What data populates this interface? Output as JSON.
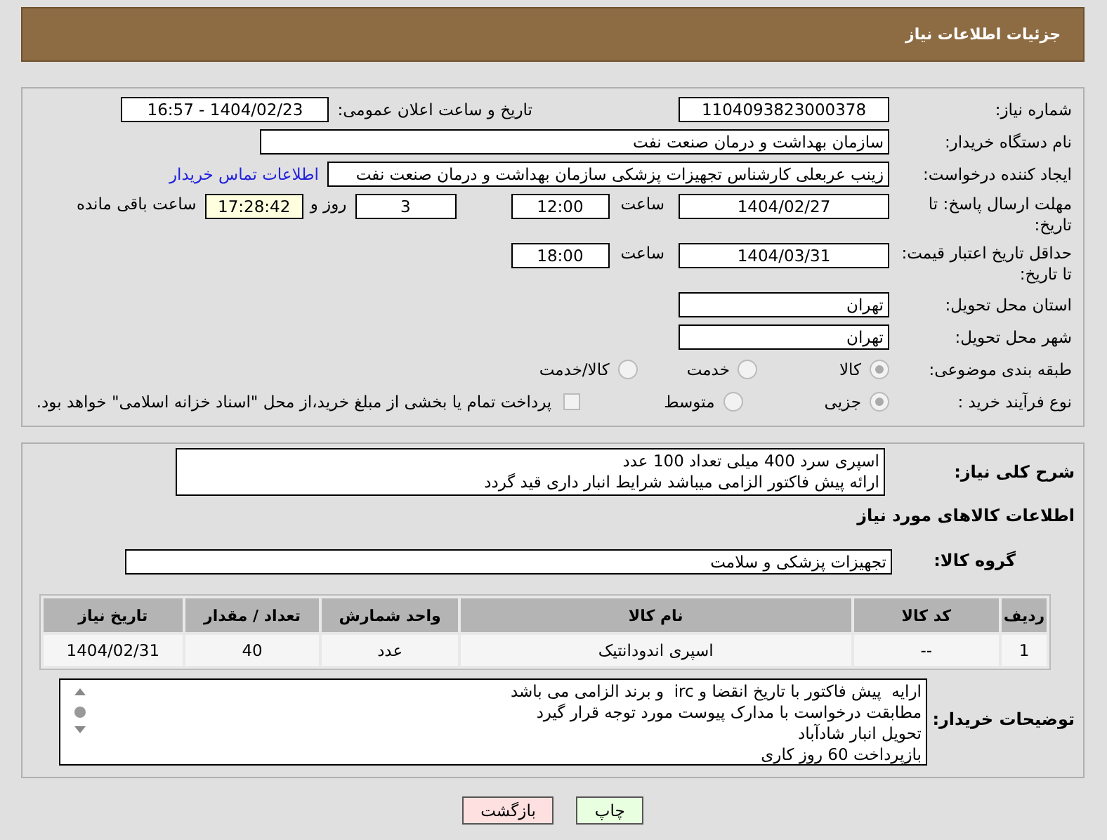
{
  "header": {
    "title": "جزئیات اطلاعات نیاز"
  },
  "need_number": {
    "label": "شماره نیاز:",
    "value": "1104093823000378"
  },
  "announce": {
    "label": "تاریخ و ساعت اعلان عمومی:",
    "value": "1404/02/23 - 16:57"
  },
  "buyer_org": {
    "label": "نام دستگاه خریدار:",
    "value": "سازمان بهداشت و درمان صنعت نفت"
  },
  "requester": {
    "label": "ایجاد کننده درخواست:",
    "value": "زینب عربعلی کارشناس تجهیزات پزشکی سازمان بهداشت و درمان صنعت نفت",
    "link": "اطلاعات تماس خریدار"
  },
  "deadline": {
    "label": "مهلت ارسال پاسخ: تا تاریخ:",
    "date": "1404/02/27",
    "time_label": "ساعت",
    "time": "12:00",
    "days": "3",
    "days_label": "روز و",
    "remaining": "17:28:42",
    "remaining_label": "ساعت باقی مانده"
  },
  "validity": {
    "label": "حداقل تاریخ اعتبار قیمت: تا تاریخ:",
    "date": "1404/03/31",
    "time_label": "ساعت",
    "time": "18:00"
  },
  "province": {
    "label": "استان محل تحویل:",
    "value": "تهران"
  },
  "city": {
    "label": "شهر محل تحویل:",
    "value": "تهران"
  },
  "category": {
    "label": "طبقه بندی موضوعی:",
    "options": [
      {
        "label": "کالا",
        "selected": true
      },
      {
        "label": "خدمت",
        "selected": false
      },
      {
        "label": "کالا/خدمت",
        "selected": false
      }
    ]
  },
  "process": {
    "label": "نوع فرآیند خرید :",
    "options": [
      {
        "label": "جزیی",
        "selected": true
      },
      {
        "label": "متوسط",
        "selected": false
      }
    ],
    "treasury": {
      "checked": false,
      "label": "پرداخت تمام یا بخشی از مبلغ خرید،از محل \"اسناد خزانه اسلامی\" خواهد بود."
    }
  },
  "description": {
    "label": "شرح کلی نیاز:",
    "lines": [
      "اسپری سرد 400 میلی تعداد 100 عدد",
      "ارائه پیش فاکتور الزامی میباشد شرایط انبار داری قید گردد"
    ]
  },
  "goods_heading": "اطلاعات کالاهای مورد نیاز",
  "goods_group": {
    "label": "گروه کالا:",
    "value": "تجهیزات پزشکی و سلامت"
  },
  "table": {
    "columns": [
      "ردیف",
      "کد کالا",
      "نام کالا",
      "واحد شمارش",
      "تعداد / مقدار",
      "تاریخ نیاز"
    ],
    "rows": [
      [
        "1",
        "--",
        "اسپری اندودانتیک",
        "عدد",
        "40",
        "1404/02/31"
      ]
    ]
  },
  "buyer_notes": {
    "label": "توضیحات خریدار:",
    "lines": [
      "ارایه  پیش فاکتور با تاریخ انقضا و irc  و برند الزامی می باشد",
      "مطابقت درخواست با مدارک پیوست مورد توجه قرار گیرد",
      "تحویل انبار شادآباد",
      "بازپرداخت 60 روز کاری"
    ]
  },
  "buttons": {
    "print": "چاپ",
    "back": "بازگشت"
  }
}
